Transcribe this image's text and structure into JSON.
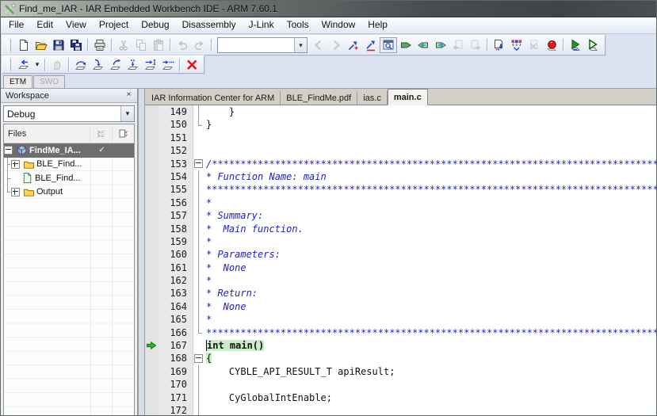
{
  "window": {
    "title": "Find_me_IAR - IAR Embedded Workbench IDE - ARM 7.60.1"
  },
  "menu": {
    "items": [
      "File",
      "Edit",
      "View",
      "Project",
      "Debug",
      "Disassembly",
      "J-Link",
      "Tools",
      "Window",
      "Help"
    ]
  },
  "toolbar_main": {
    "items": [
      {
        "icon": "new-document-icon"
      },
      {
        "icon": "open-file-icon"
      },
      {
        "icon": "save-icon"
      },
      {
        "icon": "save-all-icon"
      },
      {
        "sep": true
      },
      {
        "icon": "print-icon"
      },
      {
        "sep": true
      },
      {
        "icon": "cut-icon",
        "disabled": true
      },
      {
        "icon": "copy-icon",
        "disabled": true
      },
      {
        "icon": "paste-icon",
        "disabled": true
      },
      {
        "sep": true
      },
      {
        "icon": "undo-icon",
        "disabled": true
      },
      {
        "icon": "redo-icon",
        "disabled": true
      },
      {
        "sep": true
      },
      {
        "combo": "",
        "name": "quick-search-combobox"
      },
      {
        "icon": "goto-previous-icon",
        "disabled": true
      },
      {
        "icon": "goto-next-icon",
        "disabled": true
      },
      {
        "icon": "toggle-bookmark-icon"
      },
      {
        "icon": "next-bookmark-icon"
      },
      {
        "icon": "find-in-files-icon",
        "pressed": true
      },
      {
        "icon": "go-to-icon"
      },
      {
        "icon": "navigate-back-icon"
      },
      {
        "icon": "navigate-forward-icon"
      },
      {
        "icon": "browse-back-icon",
        "disabled": true
      },
      {
        "icon": "browse-forward-icon",
        "disabled": true
      },
      {
        "sep": true
      },
      {
        "icon": "make-icon"
      },
      {
        "icon": "compile-icon"
      },
      {
        "icon": "stop-build-icon",
        "disabled": true
      },
      {
        "icon": "toggle-breakpoint-icon"
      },
      {
        "sep": true
      },
      {
        "icon": "download-debug-icon"
      },
      {
        "icon": "debug-without-download-icon"
      }
    ]
  },
  "toolbar_debug": {
    "items": [
      {
        "icon": "reset-icon"
      },
      {
        "drop": true,
        "glyph": "▾"
      },
      {
        "sep": true
      },
      {
        "icon": "break-icon",
        "disabled": true
      },
      {
        "sep": true
      },
      {
        "icon": "step-over-icon"
      },
      {
        "icon": "step-into-icon"
      },
      {
        "icon": "step-out-icon"
      },
      {
        "icon": "next-statement-icon"
      },
      {
        "icon": "run-to-cursor-icon"
      },
      {
        "icon": "autostep-icon"
      },
      {
        "sep": true
      },
      {
        "icon": "stop-debug-icon"
      }
    ]
  },
  "trace_tabs": {
    "items": [
      {
        "label": "ETM",
        "enabled": true
      },
      {
        "label": "SWO",
        "enabled": false
      }
    ]
  },
  "workspace": {
    "title": "Workspace",
    "close_glyph": "×",
    "config": "Debug",
    "files_header": "Files",
    "tree": [
      {
        "label": "FindMe_IA...",
        "icon": "project-icon",
        "expander": "minus",
        "selected": true,
        "check": "✓",
        "root": true
      },
      {
        "label": "BLE_Find...",
        "icon": "folder-icon",
        "expander": "plus",
        "conn": "tee"
      },
      {
        "label": "BLE_Find...",
        "icon": "file-icon",
        "conn": "tee"
      },
      {
        "label": "Output",
        "icon": "folder-icon",
        "expander": "plus",
        "conn": "ell"
      }
    ]
  },
  "editor": {
    "tabs": [
      {
        "label": "IAR Information Center for ARM"
      },
      {
        "label": "BLE_FindMe.pdf"
      },
      {
        "label": "ias.c"
      },
      {
        "label": "main.c",
        "active": true
      }
    ],
    "lines": [
      {
        "n": "149",
        "t": "    }",
        "f": "line"
      },
      {
        "n": "150",
        "t": "}",
        "f": "end"
      },
      {
        "n": "151",
        "t": ""
      },
      {
        "n": "152",
        "t": ""
      },
      {
        "n": "153",
        "t": "/***********************************************************************************************",
        "c": "comment",
        "f": "box"
      },
      {
        "n": "154",
        "t": "* Function Name: main",
        "c": "comment",
        "f": "line"
      },
      {
        "n": "155",
        "t": "************************************************************************************************",
        "c": "comment",
        "f": "line"
      },
      {
        "n": "156",
        "t": "*",
        "c": "comment",
        "f": "line"
      },
      {
        "n": "157",
        "t": "* Summary:",
        "c": "comment",
        "f": "line"
      },
      {
        "n": "158",
        "t": "*  Main function.",
        "c": "comment",
        "f": "line"
      },
      {
        "n": "159",
        "t": "*",
        "c": "comment",
        "f": "line"
      },
      {
        "n": "160",
        "t": "* Parameters:",
        "c": "comment",
        "f": "line"
      },
      {
        "n": "161",
        "t": "*  None",
        "c": "comment",
        "f": "line"
      },
      {
        "n": "162",
        "t": "*",
        "c": "comment",
        "f": "line"
      },
      {
        "n": "163",
        "t": "* Return:",
        "c": "comment",
        "f": "line"
      },
      {
        "n": "164",
        "t": "*  None",
        "c": "comment",
        "f": "line"
      },
      {
        "n": "165",
        "t": "*",
        "c": "comment",
        "f": "line"
      },
      {
        "n": "166",
        "t": "************************************************************************************************",
        "c": "comment",
        "f": "end"
      },
      {
        "n": "167",
        "t": "int main()",
        "c": "kw",
        "hl": true,
        "cur": true,
        "caret": true
      },
      {
        "n": "168",
        "t": "{",
        "hl": true,
        "f": "box"
      },
      {
        "n": "169",
        "t": "    CYBLE_API_RESULT_T apiResult;",
        "f": "line"
      },
      {
        "n": "170",
        "t": "",
        "f": "line"
      },
      {
        "n": "171",
        "t": "    CyGlobalIntEnable;",
        "f": "line"
      },
      {
        "n": "172",
        "t": "",
        "f": "line"
      }
    ]
  },
  "colors": {
    "comment_blue": "#2121c4",
    "highlight_green": "#c9ecc9",
    "breakpoint_red": "#e01818",
    "current_arrow_green": "#21c121",
    "selection_gray": "#6e6e6e",
    "folder_yellow": "#ffd24a",
    "toolbar_bg": "#dbe2f1"
  }
}
